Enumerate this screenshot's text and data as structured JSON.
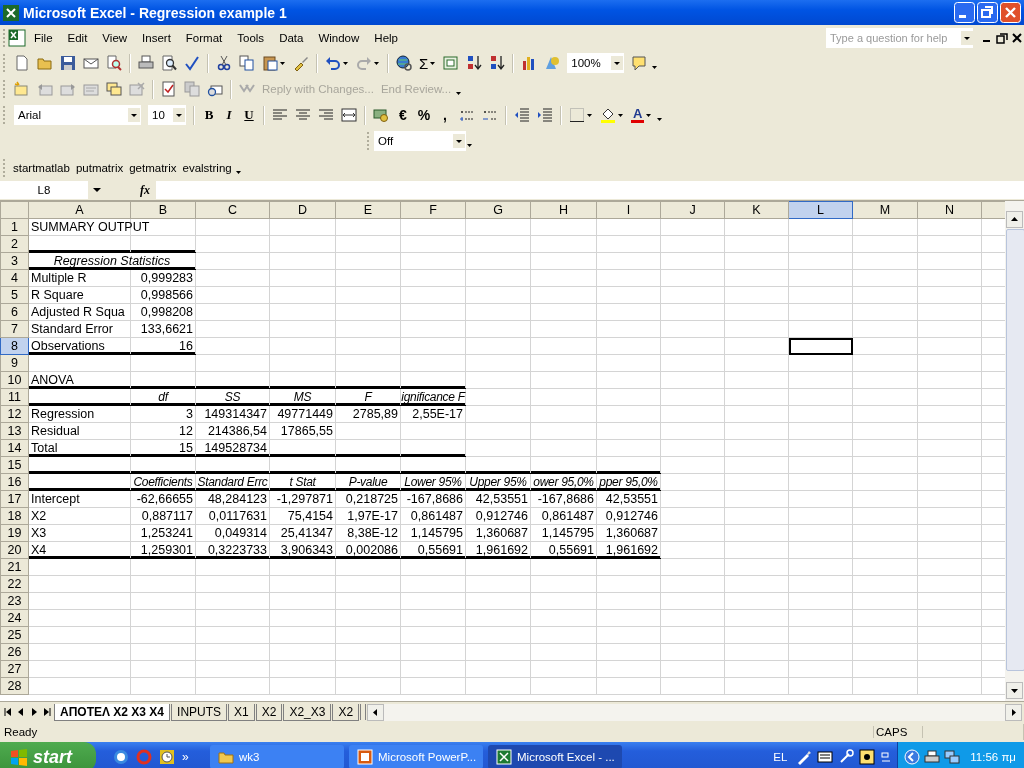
{
  "window": {
    "title": "Microsoft Excel - Regression example 1"
  },
  "menu": {
    "items": [
      "File",
      "Edit",
      "View",
      "Insert",
      "Format",
      "Tools",
      "Data",
      "Window",
      "Help"
    ],
    "help_box": {
      "placeholder": "Type a question for help"
    }
  },
  "standard_toolbar": {
    "sum": "Σ",
    "zoom": "100%"
  },
  "reviewing_toolbar": {
    "buttons": [
      {
        "label": "Reply with Changes...",
        "disabled": true
      },
      {
        "label": "End Review...",
        "disabled": true
      }
    ]
  },
  "formatting_toolbar": {
    "font": "Arial",
    "size": "10",
    "bold": "B",
    "italic": "I",
    "underline": "U",
    "euro": "€",
    "percent": "%",
    "comma": ",",
    "font_color": "A"
  },
  "off_toolbar": {
    "value": "Off"
  },
  "matlab_toolbar": {
    "buttons": [
      "startmatlab",
      "putmatrix",
      "getmatrix",
      "evalstring"
    ]
  },
  "formula_bar": {
    "name_box": "L8",
    "function_label": "fx"
  },
  "sheet": {
    "columns": [
      {
        "label": "A",
        "selected": false
      },
      {
        "label": "B",
        "selected": false
      },
      {
        "label": "C",
        "selected": false
      },
      {
        "label": "D",
        "selected": false
      },
      {
        "label": "E",
        "selected": false
      },
      {
        "label": "F",
        "selected": false
      },
      {
        "label": "G",
        "selected": false
      },
      {
        "label": "H",
        "selected": false
      },
      {
        "label": "I",
        "selected": false
      },
      {
        "label": "J",
        "selected": false
      },
      {
        "label": "K",
        "selected": false
      },
      {
        "label": "L",
        "selected": true
      },
      {
        "label": "M",
        "selected": false
      },
      {
        "label": "N",
        "selected": false
      }
    ],
    "rows": [
      {
        "number": "1",
        "selected": false,
        "cells": [
          {
            "kind": "label",
            "text": "SUMMARY OUTPUT",
            "rule_below": false
          }
        ]
      },
      {
        "number": "2",
        "selected": false,
        "cells": [
          {
            "rule_below": true
          },
          {
            "rule_below": true
          }
        ]
      },
      {
        "number": "3",
        "selected": false,
        "cells": [
          {
            "kind": "caption",
            "text": "Regression Statistics",
            "rule_below": true
          }
        ]
      },
      {
        "number": "4",
        "selected": false,
        "cells": [
          {
            "kind": "label",
            "text": "Multiple R",
            "rule_below": false
          },
          {
            "kind": "number",
            "text": "0,999283",
            "rule_below": false
          }
        ]
      },
      {
        "number": "5",
        "selected": false,
        "cells": [
          {
            "kind": "label",
            "text": "R Square",
            "rule_below": false
          },
          {
            "kind": "number",
            "text": "0,998566",
            "rule_below": false
          }
        ]
      },
      {
        "number": "6",
        "selected": false,
        "cells": [
          {
            "kind": "label",
            "text": "Adjusted R Squa",
            "rule_below": false
          },
          {
            "kind": "number",
            "text": "0,998208",
            "rule_below": false
          }
        ]
      },
      {
        "number": "7",
        "selected": false,
        "cells": [
          {
            "kind": "label",
            "text": "Standard Error",
            "rule_below": false
          },
          {
            "kind": "number",
            "text": "133,6621",
            "rule_below": false
          }
        ]
      },
      {
        "number": "8",
        "selected": true,
        "cells": [
          {
            "kind": "label",
            "text": "Observations",
            "rule_below": true
          },
          {
            "kind": "number",
            "text": "16",
            "rule_below": true
          }
        ]
      },
      {
        "number": "9",
        "selected": false
      },
      {
        "number": "10",
        "selected": false,
        "cells": [
          {
            "kind": "label",
            "text": "ANOVA",
            "rule_below": true
          },
          {
            "rule_below": true
          },
          {
            "rule_below": true
          },
          {
            "rule_below": true
          },
          {
            "rule_below": true
          },
          {
            "rule_below": true
          }
        ]
      },
      {
        "number": "11",
        "selected": false,
        "cells": [
          {
            "rule_below": true
          },
          {
            "kind": "heading",
            "text": "df",
            "rule_below": true
          },
          {
            "kind": "heading",
            "text": "SS",
            "rule_below": true
          },
          {
            "kind": "heading",
            "text": "MS",
            "rule_below": true
          },
          {
            "kind": "heading",
            "text": "F",
            "rule_below": true
          },
          {
            "kind": "heading",
            "text": "ignificance F",
            "rule_below": true
          }
        ]
      },
      {
        "number": "12",
        "selected": false,
        "cells": [
          {
            "kind": "label",
            "text": "Regression",
            "rule_below": false
          },
          {
            "kind": "number",
            "text": "3",
            "rule_below": false
          },
          {
            "kind": "number",
            "text": "149314347",
            "rule_below": false
          },
          {
            "kind": "number",
            "text": "49771449",
            "rule_below": false
          },
          {
            "kind": "number",
            "text": "2785,89",
            "rule_below": false
          },
          {
            "kind": "number",
            "text": "2,55E-17",
            "rule_below": false
          }
        ]
      },
      {
        "number": "13",
        "selected": false,
        "cells": [
          {
            "kind": "label",
            "text": "Residual",
            "rule_below": false
          },
          {
            "kind": "number",
            "text": "12",
            "rule_below": false
          },
          {
            "kind": "number",
            "text": "214386,54",
            "rule_below": false
          },
          {
            "kind": "number",
            "text": "17865,55",
            "rule_below": false
          }
        ]
      },
      {
        "number": "14",
        "selected": false,
        "cells": [
          {
            "kind": "label",
            "text": "Total",
            "rule_below": true
          },
          {
            "kind": "number",
            "text": "15",
            "rule_below": true
          },
          {
            "kind": "number",
            "text": "149528734",
            "rule_below": true
          },
          {
            "rule_below": true
          },
          {
            "rule_below": true
          },
          {
            "rule_below": true
          }
        ]
      },
      {
        "number": "15",
        "selected": false,
        "cells": [
          {
            "rule_below": true
          },
          {
            "rule_below": true
          },
          {
            "rule_below": true
          },
          {
            "rule_below": true
          },
          {
            "rule_below": true
          },
          {
            "rule_below": true
          },
          {
            "rule_below": true
          },
          {
            "rule_below": true
          },
          {
            "rule_below": true
          }
        ]
      },
      {
        "number": "16",
        "selected": false,
        "cells": [
          {
            "rule_below": true
          },
          {
            "kind": "heading",
            "text": "Coefficients",
            "rule_below": true
          },
          {
            "kind": "heading",
            "text": "Standard Errc",
            "rule_below": true
          },
          {
            "kind": "heading",
            "text": "t Stat",
            "rule_below": true
          },
          {
            "kind": "heading",
            "text": "P-value",
            "rule_below": true
          },
          {
            "kind": "heading",
            "text": "Lower 95%",
            "rule_below": true
          },
          {
            "kind": "heading",
            "text": "Upper 95%",
            "rule_below": true
          },
          {
            "kind": "heading",
            "text": "ower 95,0%",
            "rule_below": true
          },
          {
            "kind": "heading",
            "text": "pper 95,0%",
            "rule_below": true
          }
        ]
      },
      {
        "number": "17",
        "selected": false,
        "cells": [
          {
            "kind": "label",
            "text": "Intercept",
            "rule_below": false
          },
          {
            "kind": "number",
            "text": "-62,66655",
            "rule_below": false
          },
          {
            "kind": "number",
            "text": "48,284123",
            "rule_below": false
          },
          {
            "kind": "number",
            "text": "-1,297871",
            "rule_below": false
          },
          {
            "kind": "number",
            "text": "0,218725",
            "rule_below": false
          },
          {
            "kind": "number",
            "text": "-167,8686",
            "rule_below": false
          },
          {
            "kind": "number",
            "text": "42,53551",
            "rule_below": false
          },
          {
            "kind": "number",
            "text": "-167,8686",
            "rule_below": false
          },
          {
            "kind": "number",
            "text": "42,53551",
            "rule_below": false
          }
        ]
      },
      {
        "number": "18",
        "selected": false,
        "cells": [
          {
            "kind": "label",
            "text": "X2",
            "rule_below": false
          },
          {
            "kind": "number",
            "text": "0,887117",
            "rule_below": false
          },
          {
            "kind": "number",
            "text": "0,0117631",
            "rule_below": false
          },
          {
            "kind": "number",
            "text": "75,4154",
            "rule_below": false
          },
          {
            "kind": "number",
            "text": "1,97E-17",
            "rule_below": false
          },
          {
            "kind": "number",
            "text": "0,861487",
            "rule_below": false
          },
          {
            "kind": "number",
            "text": "0,912746",
            "rule_below": false
          },
          {
            "kind": "number",
            "text": "0,861487",
            "rule_below": false
          },
          {
            "kind": "number",
            "text": "0,912746",
            "rule_below": false
          }
        ]
      },
      {
        "number": "19",
        "selected": false,
        "cells": [
          {
            "kind": "label",
            "text": "X3",
            "rule_below": false
          },
          {
            "kind": "number",
            "text": "1,253241",
            "rule_below": false
          },
          {
            "kind": "number",
            "text": "0,049314",
            "rule_below": false
          },
          {
            "kind": "number",
            "text": "25,41347",
            "rule_below": false
          },
          {
            "kind": "number",
            "text": "8,38E-12",
            "rule_below": false
          },
          {
            "kind": "number",
            "text": "1,145795",
            "rule_below": false
          },
          {
            "kind": "number",
            "text": "1,360687",
            "rule_below": false
          },
          {
            "kind": "number",
            "text": "1,145795",
            "rule_below": false
          },
          {
            "kind": "number",
            "text": "1,360687",
            "rule_below": false
          }
        ]
      },
      {
        "number": "20",
        "selected": false,
        "cells": [
          {
            "kind": "label",
            "text": "X4",
            "rule_below": true
          },
          {
            "kind": "number",
            "text": "1,259301",
            "rule_below": true
          },
          {
            "kind": "number",
            "text": "0,3223733",
            "rule_below": true
          },
          {
            "kind": "number",
            "text": "3,906343",
            "rule_below": true
          },
          {
            "kind": "number",
            "text": "0,002086",
            "rule_below": true
          },
          {
            "kind": "number",
            "text": "0,55691",
            "rule_below": true
          },
          {
            "kind": "number",
            "text": "1,961692",
            "rule_below": true
          },
          {
            "kind": "number",
            "text": "0,55691",
            "rule_below": true
          },
          {
            "kind": "number",
            "text": "1,961692",
            "rule_below": true
          }
        ]
      },
      {
        "number": "21",
        "selected": false
      },
      {
        "number": "22",
        "selected": false
      },
      {
        "number": "23",
        "selected": false
      },
      {
        "number": "24",
        "selected": false
      },
      {
        "number": "25",
        "selected": false
      },
      {
        "number": "26",
        "selected": false
      },
      {
        "number": "27",
        "selected": false
      },
      {
        "number": "28",
        "selected": false
      }
    ]
  },
  "sheet_tabs": [
    {
      "label": "ΑΠΟΤΕΛ  X2 X3 X4",
      "selected": true
    },
    {
      "label": "INPUTS",
      "selected": false
    },
    {
      "label": "X1",
      "selected": false
    },
    {
      "label": "X2",
      "selected": false
    },
    {
      "label": "X2_X3",
      "selected": false
    },
    {
      "label": "X2",
      "selected": false
    }
  ],
  "status_bar": {
    "status": "Ready",
    "indicator": "CAPS"
  },
  "taskbar": {
    "start": "start",
    "more": "»",
    "tasks": [
      {
        "kind": "folder",
        "label": "wk3",
        "selected": false
      },
      {
        "kind": "powerpoint",
        "label": "Microsoft PowerP...",
        "selected": false
      },
      {
        "kind": "excel",
        "label": "Microsoft Excel - ...",
        "selected": true
      }
    ],
    "language": "EL",
    "clock": "11:56 πμ"
  }
}
